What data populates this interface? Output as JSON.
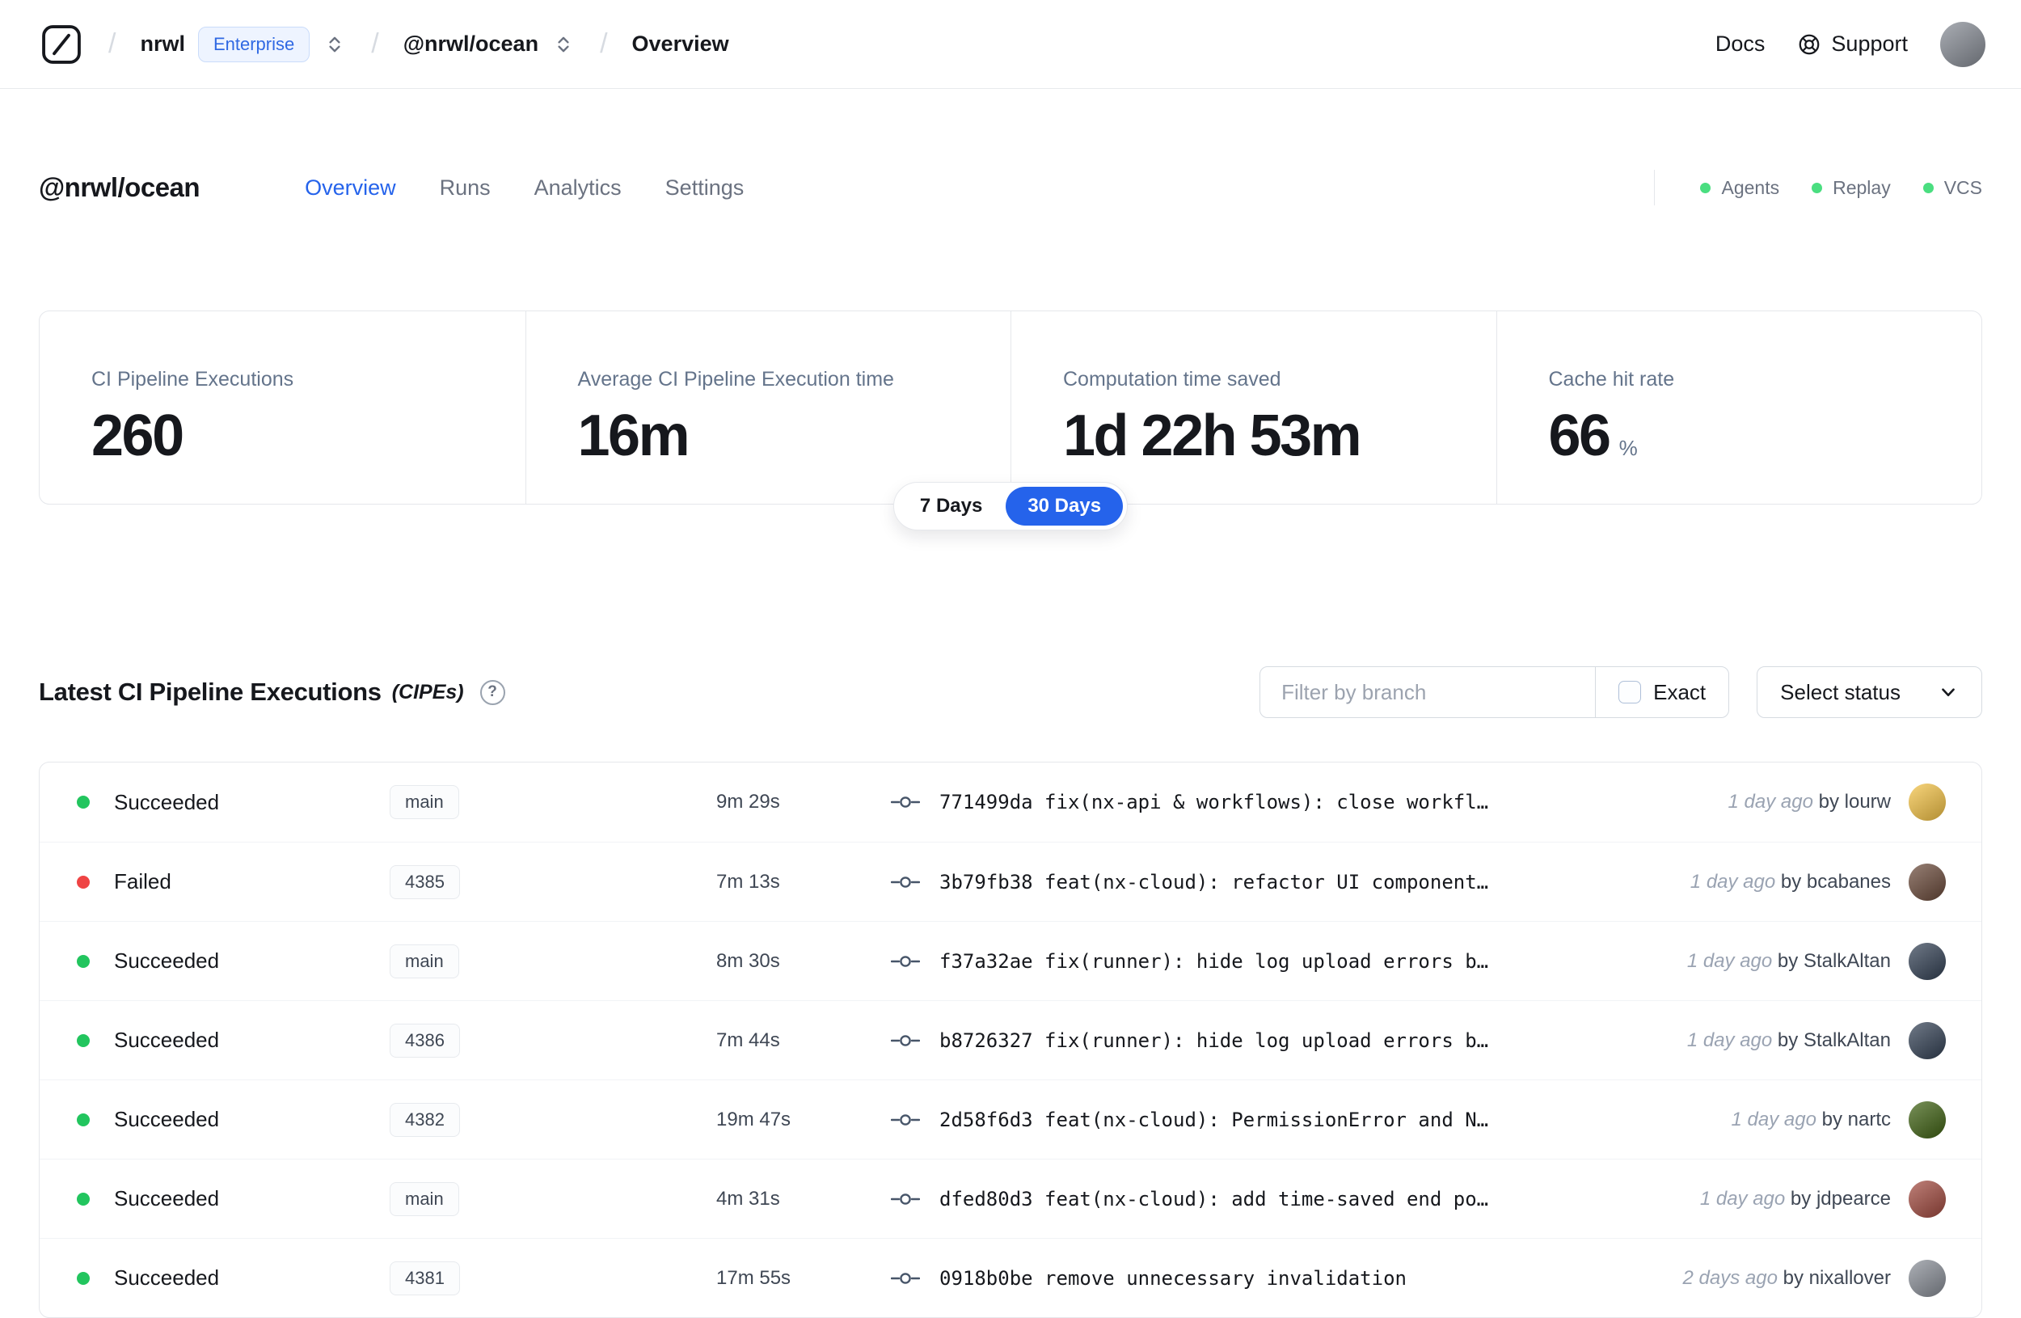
{
  "colors": {
    "accent": "#2563eb",
    "success": "#22c55e",
    "danger": "#ef4444",
    "status_dot": "#4ade80"
  },
  "navbar": {
    "separator": "/",
    "org": "nrwl",
    "org_badge": "Enterprise",
    "workspace": "@nrwl/ocean",
    "page": "Overview",
    "docs_label": "Docs",
    "support_label": "Support",
    "avatar_color": "#8a8f98"
  },
  "header": {
    "title": "@nrwl/ocean",
    "tabs": [
      {
        "label": "Overview",
        "active": true
      },
      {
        "label": "Runs",
        "active": false
      },
      {
        "label": "Analytics",
        "active": false
      },
      {
        "label": "Settings",
        "active": false
      }
    ],
    "statuses": [
      {
        "label": "Agents"
      },
      {
        "label": "Replay"
      },
      {
        "label": "VCS"
      }
    ],
    "status_dot_color": "#4ade80"
  },
  "stats": {
    "cards": [
      {
        "label": "CI Pipeline Executions",
        "value": "260",
        "suffix": ""
      },
      {
        "label": "Average CI Pipeline Execution time",
        "value": "16m",
        "suffix": ""
      },
      {
        "label": "Computation time saved",
        "value": "1d 22h 53m",
        "suffix": ""
      },
      {
        "label": "Cache hit rate",
        "value": "66",
        "suffix": "%"
      }
    ],
    "range_toggle": [
      {
        "label": "7 Days",
        "active": false
      },
      {
        "label": "30 Days",
        "active": true
      }
    ]
  },
  "section": {
    "title": "Latest CI Pipeline Executions",
    "title_suffix": "(CIPEs)",
    "filter_placeholder": "Filter by branch",
    "exact_label": "Exact",
    "status_button": "Select status"
  },
  "table": {
    "rows": [
      {
        "status": "Succeeded",
        "status_color": "#22c55e",
        "branch": "main",
        "duration": "9m 29s",
        "hash": "771499da",
        "message": "fix(nx-api & workflows): close workfl…",
        "time": "1 day ago",
        "author": "by lourw",
        "avatar_color": "#f6c445"
      },
      {
        "status": "Failed",
        "status_color": "#ef4444",
        "branch": "4385",
        "duration": "7m 13s",
        "hash": "3b79fb38",
        "message": "feat(nx-cloud): refactor UI component…",
        "time": "1 day ago",
        "author": "by bcabanes",
        "avatar_color": "#6b4a3a"
      },
      {
        "status": "Succeeded",
        "status_color": "#22c55e",
        "branch": "main",
        "duration": "8m 30s",
        "hash": "f37a32ae",
        "message": "fix(runner): hide log upload errors b…",
        "time": "1 day ago",
        "author": "by StalkAltan",
        "avatar_color": "#334155"
      },
      {
        "status": "Succeeded",
        "status_color": "#22c55e",
        "branch": "4386",
        "duration": "7m 44s",
        "hash": "b8726327",
        "message": "fix(runner): hide log upload errors b…",
        "time": "1 day ago",
        "author": "by StalkAltan",
        "avatar_color": "#334155"
      },
      {
        "status": "Succeeded",
        "status_color": "#22c55e",
        "branch": "4382",
        "duration": "19m 47s",
        "hash": "2d58f6d3",
        "message": "feat(nx-cloud): PermissionError and N…",
        "time": "1 day ago",
        "author": "by nartc",
        "avatar_color": "#3f6212"
      },
      {
        "status": "Succeeded",
        "status_color": "#22c55e",
        "branch": "main",
        "duration": "4m 31s",
        "hash": "dfed80d3",
        "message": "feat(nx-cloud): add time-saved end po…",
        "time": "1 day ago",
        "author": "by jdpearce",
        "avatar_color": "#a34a3f"
      },
      {
        "status": "Succeeded",
        "status_color": "#22c55e",
        "branch": "4381",
        "duration": "17m 55s",
        "hash": "0918b0be",
        "message": "remove unnecessary invalidation",
        "time": "2 days ago",
        "author": "by nixallover",
        "avatar_color": "#8a8f98"
      }
    ]
  }
}
